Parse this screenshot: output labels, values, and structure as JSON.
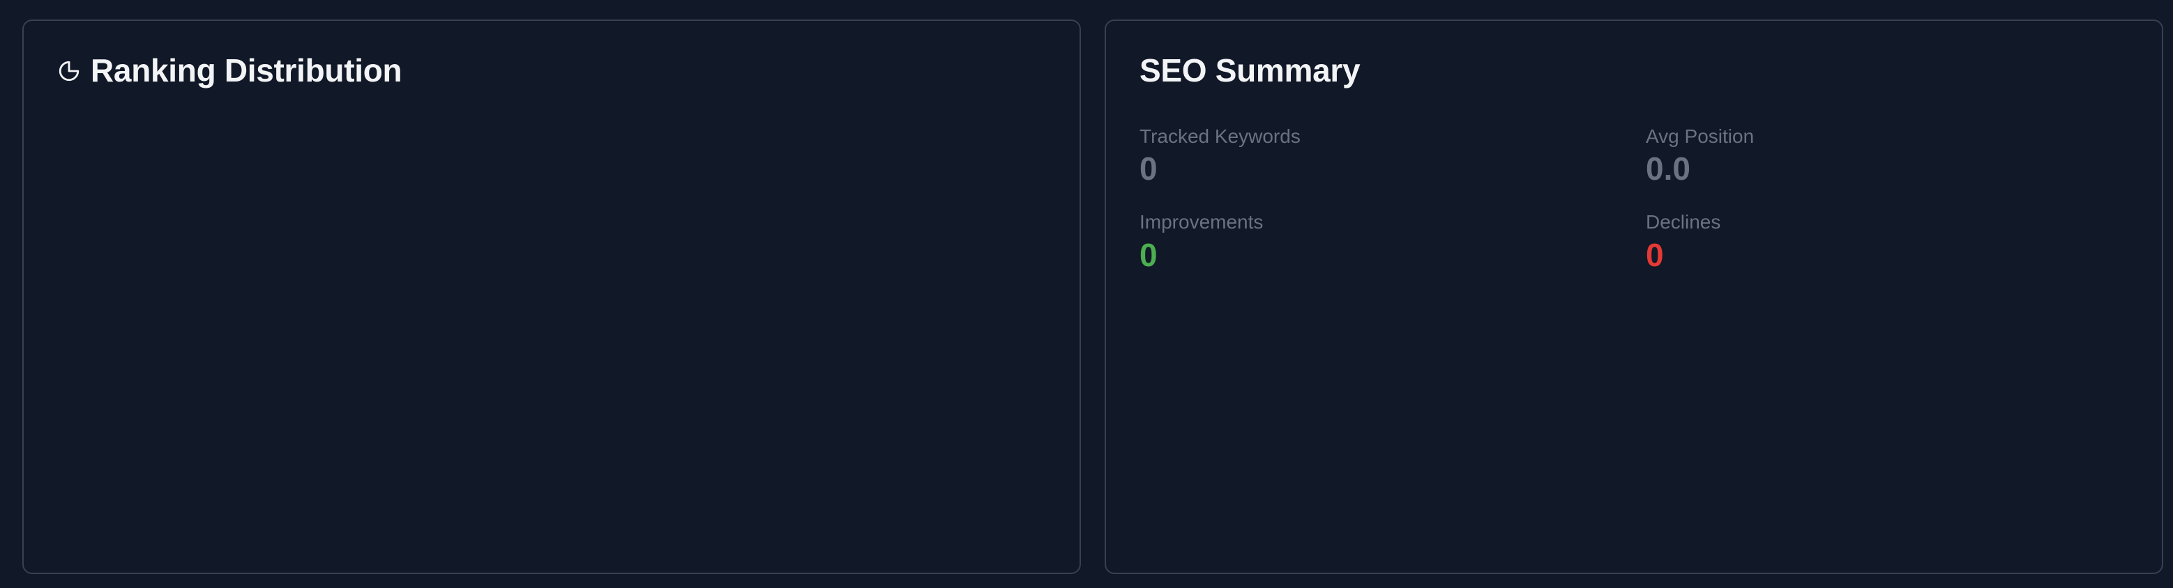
{
  "ranking": {
    "title": "Ranking Distribution",
    "icon": "pie-chart-icon"
  },
  "summary": {
    "title": "SEO Summary",
    "stats": [
      {
        "label": "Tracked Keywords",
        "value": "0",
        "color": "#6b7280"
      },
      {
        "label": "Avg Position",
        "value": "0.0",
        "color": "#6b7280"
      },
      {
        "label": "Improvements",
        "value": "0",
        "color": "#4caf50"
      },
      {
        "label": "Declines",
        "value": "0",
        "color": "#e53935"
      }
    ]
  }
}
